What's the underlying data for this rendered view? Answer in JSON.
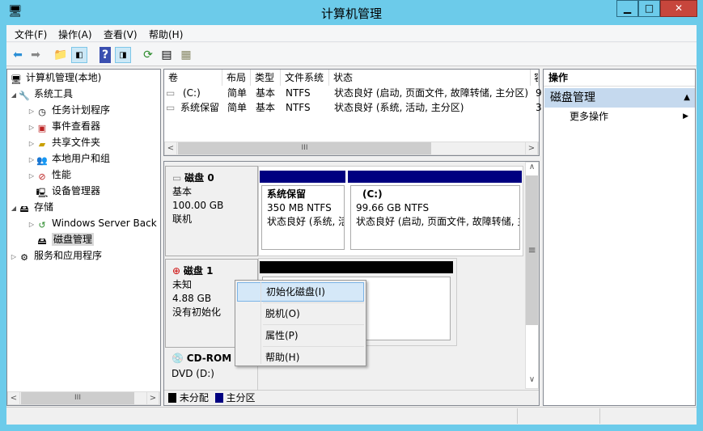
{
  "window": {
    "title": "计算机管理",
    "min": "▁",
    "max": "□",
    "close": "✕"
  },
  "menu": [
    "文件(F)",
    "操作(A)",
    "查看(V)",
    "帮助(H)"
  ],
  "toolbar": [
    "back-icon",
    "forward-icon",
    "up-folder-icon",
    "show-hide-tree-icon",
    "help-icon",
    "show-hide-action-icon",
    "refresh-icon",
    "properties-icon",
    "disk-wizard-icon"
  ],
  "tree": [
    {
      "label": "计算机管理(本地)",
      "icon": "computer-icon"
    },
    {
      "label": "系统工具",
      "icon": "tools-icon",
      "expanded": true
    },
    {
      "label": "任务计划程序",
      "icon": "clock-icon"
    },
    {
      "label": "事件查看器",
      "icon": "event-viewer-icon"
    },
    {
      "label": "共享文件夹",
      "icon": "shared-folder-icon"
    },
    {
      "label": "本地用户和组",
      "icon": "users-icon"
    },
    {
      "label": "性能",
      "icon": "performance-icon"
    },
    {
      "label": "设备管理器",
      "icon": "device-manager-icon"
    },
    {
      "label": "存储",
      "icon": "storage-icon",
      "expanded": true
    },
    {
      "label": "Windows Server Back",
      "icon": "backup-icon"
    },
    {
      "label": "磁盘管理",
      "icon": "disk-management-icon",
      "selected": true
    },
    {
      "label": "服务和应用程序",
      "icon": "services-icon"
    }
  ],
  "volumes": {
    "columns": [
      "卷",
      "布局",
      "类型",
      "文件系统",
      "状态",
      "容"
    ],
    "rows": [
      {
        "name": "(C:)",
        "layout": "简单",
        "type": "基本",
        "fs": "NTFS",
        "status": "状态良好 (启动, 页面文件, 故障转储, 主分区)",
        "cap": "9"
      },
      {
        "name": "系统保留",
        "layout": "简单",
        "type": "基本",
        "fs": "NTFS",
        "status": "状态良好 (系统, 活动, 主分区)",
        "cap": "3"
      }
    ]
  },
  "disks": [
    {
      "name": "磁盘 0",
      "kind": "基本",
      "size": "100.00 GB",
      "state": "联机",
      "partitions": [
        {
          "name": "系统保留",
          "size": "350 MB NTFS",
          "status": "状态良好 (系统, 活"
        },
        {
          "name": "(C:)",
          "size": "99.66 GB NTFS",
          "status": "状态良好 (启动, 页面文件, 故障转储, 主"
        }
      ]
    },
    {
      "name": "磁盘 1",
      "kind": "未知",
      "size": "4.88 GB",
      "state": "没有初始化"
    },
    {
      "name": "CD-ROM",
      "kind": "DVD (D:)"
    }
  ],
  "legend": [
    {
      "label": "未分配",
      "color": "#000000"
    },
    {
      "label": "主分区",
      "color": "#000080"
    }
  ],
  "context_menu": [
    "初始化磁盘(I)",
    "脱机(O)",
    "属性(P)",
    "帮助(H)"
  ],
  "actions": {
    "header": "操作",
    "section": "磁盘管理",
    "more": "更多操作"
  },
  "colors": {
    "titlebar": "#6ccbea",
    "primary_partition": "#000080",
    "unallocated": "#000000",
    "selection": "#cce8ff"
  }
}
